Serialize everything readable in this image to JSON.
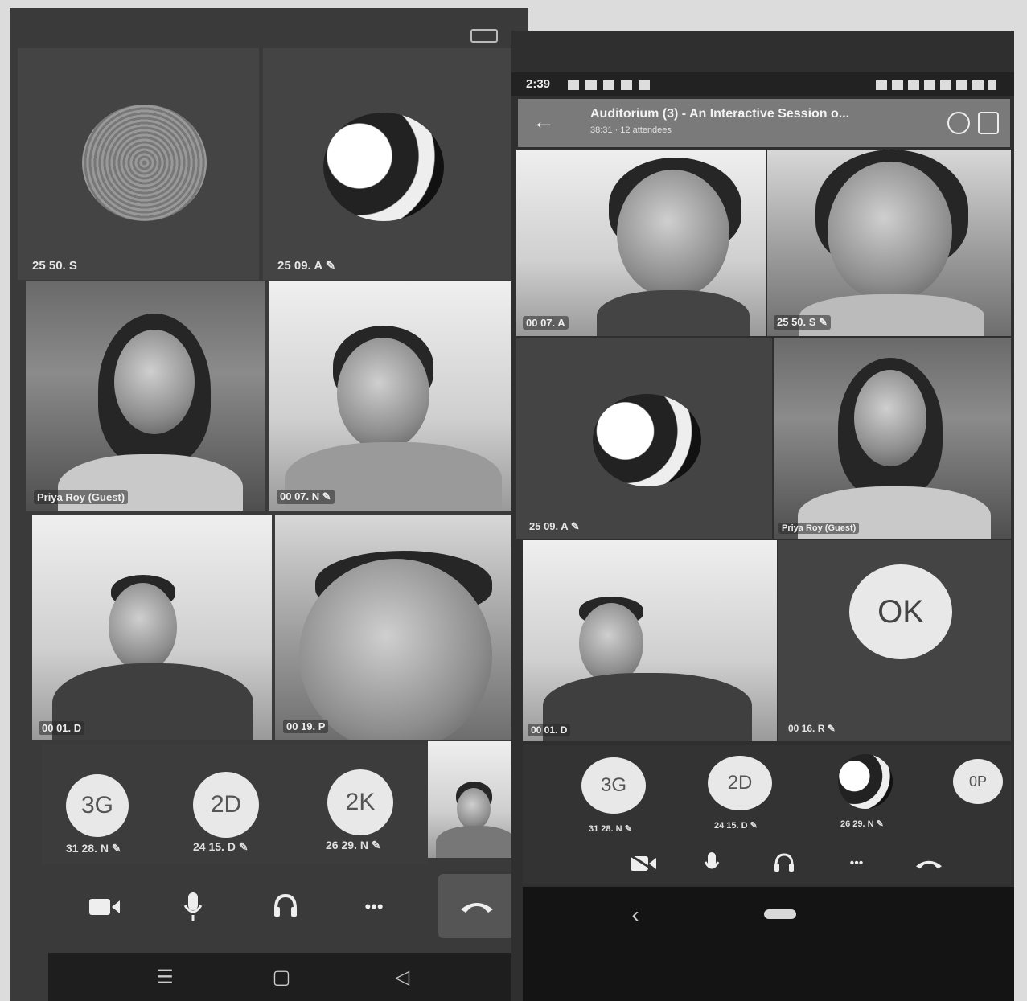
{
  "left_phone": {
    "status": {
      "battery_icon": "battery-icon"
    },
    "tiles": [
      {
        "name": "25 50. S"
      },
      {
        "name": "25 09. A ✎"
      },
      {
        "name": "Priya Roy (Guest)"
      },
      {
        "name": "00 07. N ✎"
      },
      {
        "name": "00 01. D"
      },
      {
        "name": "00 19. P"
      }
    ],
    "overflow": [
      {
        "initials": "3G",
        "label": "31 28. N ✎"
      },
      {
        "initials": "2D",
        "label": "24 15. D ✎"
      },
      {
        "initials": "2K",
        "label": "26 29. N ✎"
      }
    ],
    "controls": {
      "camera_icon": "video-camera-icon",
      "mic_icon": "microphone-icon",
      "audio_icon": "headset-icon",
      "more_label": "•••",
      "hangup_icon": "hang-up-icon"
    },
    "system_nav": {
      "menu": "☰",
      "home": "▢",
      "back": "◁"
    }
  },
  "right_phone": {
    "status_bar": {
      "time": "2:39"
    },
    "header": {
      "title": "Auditorium (3) - An Interactive Session o...",
      "subtitle": "38:31 · 12 attendees"
    },
    "tiles": [
      {
        "name": "00 07. A"
      },
      {
        "name": "25 50. S ✎"
      },
      {
        "name": "25 09. A ✎"
      },
      {
        "name": "Priya Roy (Guest)"
      },
      {
        "name": "00 01. D"
      },
      {
        "initials": "OK",
        "name": "00 16. R ✎"
      }
    ],
    "overflow": [
      {
        "initials": "3G",
        "label": "31 28. N ✎"
      },
      {
        "initials": "2D",
        "label": "24 15. D ✎"
      },
      {
        "initials": "",
        "label": "26 29. N ✎"
      },
      {
        "initials": "0P",
        "label": ""
      }
    ],
    "controls": {
      "camera_icon": "video-camera-off-icon",
      "mic_icon": "microphone-icon",
      "audio_icon": "headset-icon",
      "more_label": "•••",
      "hangup_icon": "hang-up-icon"
    },
    "system_nav": {
      "back": "‹",
      "home": "▬"
    }
  }
}
